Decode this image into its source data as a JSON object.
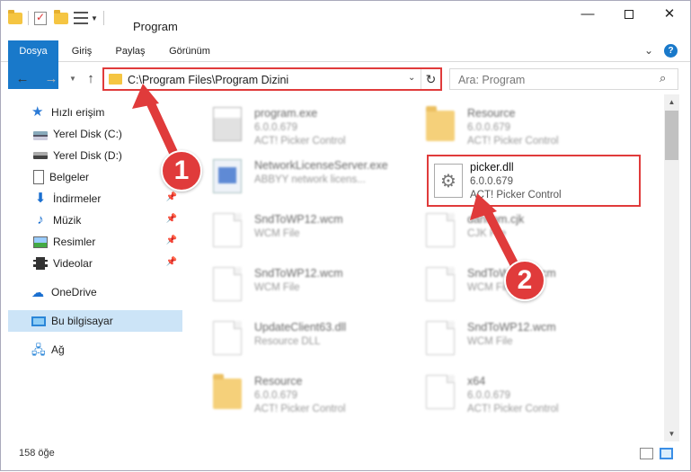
{
  "window": {
    "title": "Program"
  },
  "ribbon": {
    "tabs": [
      "Dosya",
      "Giriş",
      "Paylaş",
      "Görünüm"
    ],
    "help": "?"
  },
  "address": {
    "path": "C:\\Program Files\\Program Dizini"
  },
  "search": {
    "placeholder": "Ara: Program"
  },
  "sidebar": {
    "items": [
      {
        "label": "Hızlı erişim",
        "icon": "star-icon"
      },
      {
        "label": "Yerel Disk (C:)",
        "icon": "drive-icon"
      },
      {
        "label": "Yerel Disk (D:)",
        "icon": "drive-icon"
      },
      {
        "label": "Belgeler",
        "icon": "documents-icon"
      },
      {
        "label": "İndirmeler",
        "icon": "downloads-icon"
      },
      {
        "label": "Müzik",
        "icon": "music-icon"
      },
      {
        "label": "Resimler",
        "icon": "pictures-icon"
      },
      {
        "label": "Videolar",
        "icon": "videos-icon"
      },
      {
        "label": "OneDrive",
        "icon": "cloud-icon"
      },
      {
        "label": "Bu bilgisayar",
        "icon": "computer-icon"
      },
      {
        "label": "Ağ",
        "icon": "network-icon"
      }
    ]
  },
  "files": [
    {
      "name": "program.exe",
      "line2": "6.0.0.679",
      "line3": "ACT! Picker Control"
    },
    {
      "name": "Resource",
      "line2": "6.0.0.679",
      "line3": "ACT! Picker Control"
    },
    {
      "name": "NetworkLicenseServer.exe",
      "line2": "ABBYY network licens...",
      "line3": ""
    },
    {
      "name": "picker.dll",
      "line2": "6.0.0.679",
      "line3": "ACT! Picker Control"
    },
    {
      "name": "SndToWP12.wcm",
      "line2": "WCM File",
      "line3": ""
    },
    {
      "name": "dancom.cjk",
      "line2": "CJK File",
      "line3": ""
    },
    {
      "name": "SndToWP12.wcm",
      "line2": "WCM File",
      "line3": ""
    },
    {
      "name": "SndToWP12.wcm",
      "line2": "WCM File",
      "line3": ""
    },
    {
      "name": "UpdateClient63.dll",
      "line2": "Resource DLL",
      "line3": ""
    },
    {
      "name": "SndToWP12.wcm",
      "line2": "WCM File",
      "line3": ""
    },
    {
      "name": "Resource",
      "line2": "6.0.0.679",
      "line3": "ACT! Picker Control"
    },
    {
      "name": "x64",
      "line2": "6.0.0.679",
      "line3": "ACT! Picker Control"
    }
  ],
  "status": {
    "count": "158 öğe"
  },
  "annotations": {
    "badge1": "1",
    "badge2": "2"
  },
  "colors": {
    "accent": "#1979ca",
    "highlight": "#e03b3b"
  }
}
